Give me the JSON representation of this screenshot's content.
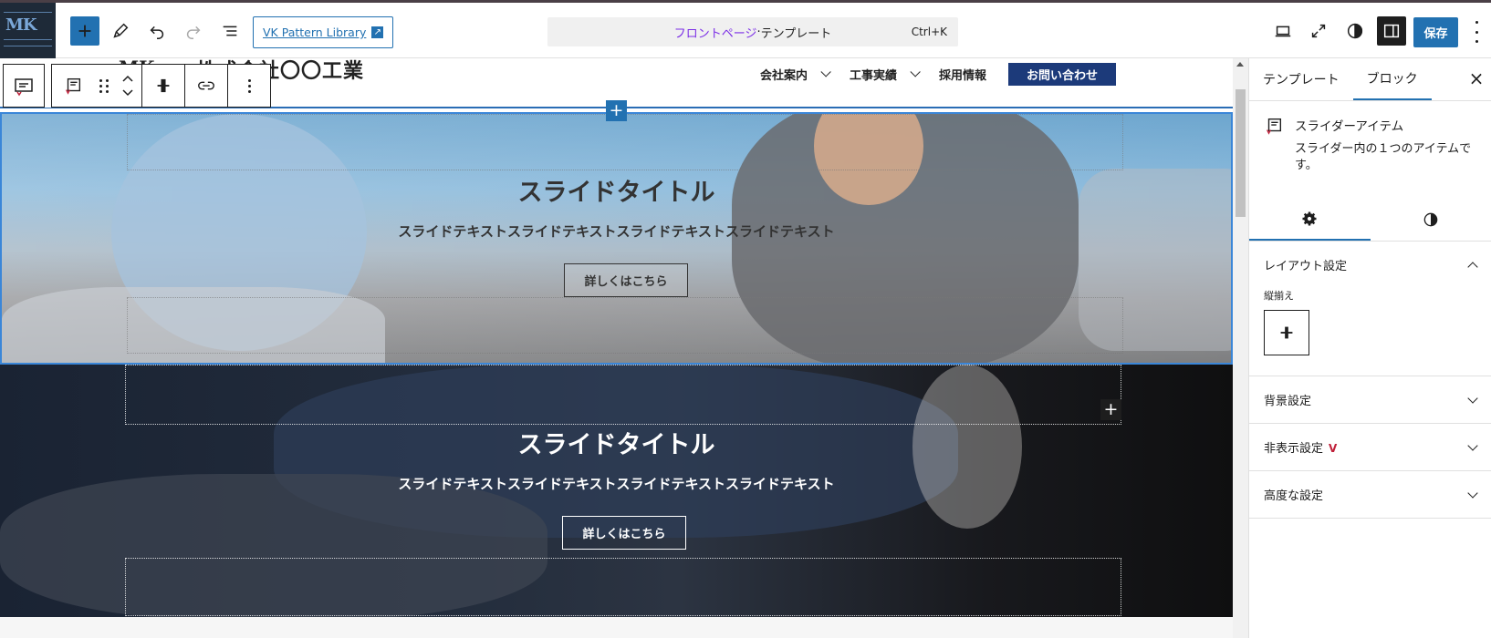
{
  "toolbar": {
    "pattern_library_label": "VK Pattern Library",
    "doc_title": "フロントページ",
    "doc_separator": " · ",
    "doc_type": "テンプレート",
    "shortcut": "Ctrl+K",
    "save_label": "保存"
  },
  "site": {
    "company_name": "株式会社〇〇工業",
    "nav": [
      {
        "label": "会社案内",
        "has_dropdown": true
      },
      {
        "label": "工事実績",
        "has_dropdown": true
      },
      {
        "label": "採用情報",
        "has_dropdown": false
      }
    ],
    "contact_label": "お問い合わせ"
  },
  "slides": [
    {
      "title": "スライドタイトル",
      "text": "スライドテキストスライドテキストスライドテキストスライドテキスト",
      "button": "詳しくはこちら"
    },
    {
      "title": "スライドタイトル",
      "text": "スライドテキストスライドテキストスライドテキストスライドテキスト",
      "button": "詳しくはこちら"
    }
  ],
  "sidebar": {
    "tabs": [
      "テンプレート",
      "ブロック"
    ],
    "active_tab": "ブロック",
    "block_name": "スライダーアイテム",
    "block_description": "スライダー内の１つのアイテムです。",
    "panels": {
      "layout": {
        "title": "レイアウト設定",
        "expanded": true,
        "valign_label": "縦揃え"
      },
      "background": {
        "title": "背景設定"
      },
      "hidden": {
        "title": "非表示設定"
      },
      "advanced": {
        "title": "高度な設定"
      }
    }
  },
  "colors": {
    "accent": "#2271b1",
    "contact_bg": "#1c3a7a",
    "doc_title": "#7b2ee6",
    "vk_mark": "#c0203a"
  }
}
